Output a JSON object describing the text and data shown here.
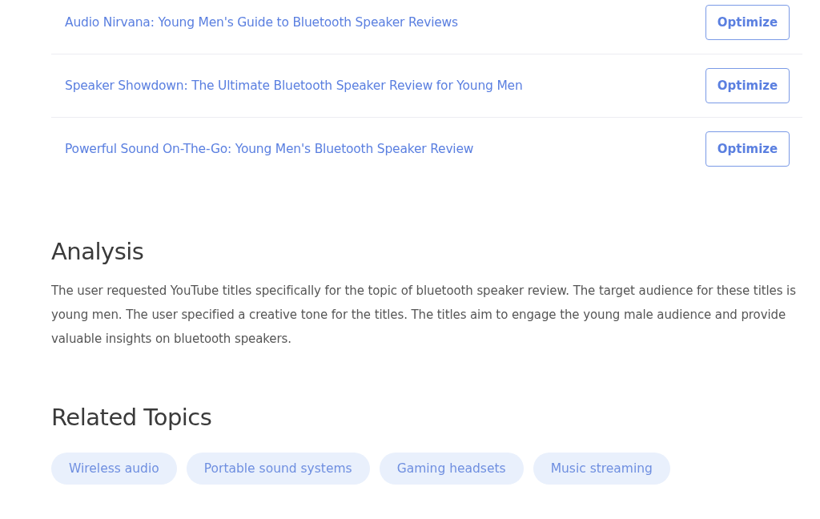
{
  "titles": [
    {
      "title": "Audio Nirvana: Young Men's Guide to Bluetooth Speaker Reviews",
      "button": "Optimize"
    },
    {
      "title": "Speaker Showdown: The Ultimate Bluetooth Speaker Review for Young Men",
      "button": "Optimize"
    },
    {
      "title": "Powerful Sound On-The-Go: Young Men's Bluetooth Speaker Review",
      "button": "Optimize"
    }
  ],
  "analysis": {
    "heading": "Analysis",
    "text": "The user requested YouTube titles specifically for the topic of bluetooth speaker review. The target audience for these titles is young men. The user specified a creative tone for the titles. The titles aim to engage the young male audience and provide valuable insights on bluetooth speakers."
  },
  "related_topics": {
    "heading": "Related Topics",
    "topics": [
      "Wireless audio",
      "Portable sound systems",
      "Gaming headsets",
      "Music streaming"
    ]
  }
}
